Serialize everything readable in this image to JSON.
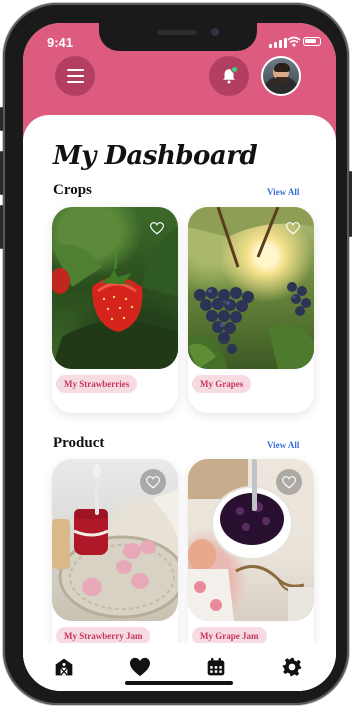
{
  "status_bar": {
    "time": "9:41"
  },
  "header": {
    "menu_icon": "hamburger-menu-icon",
    "notification_icon": "bell-icon",
    "notification_dot_color": "#39d17a",
    "avatar": "user-avatar"
  },
  "dashboard": {
    "title": "My Dashboard"
  },
  "crops": {
    "title": "Crops",
    "view_all": "View All",
    "items": [
      {
        "label": "My Strawberries",
        "image": "strawberry-plant-photo"
      },
      {
        "label": "My Grapes",
        "image": "grape-vine-photo"
      }
    ]
  },
  "products": {
    "title": "Product",
    "view_all": "View All",
    "items": [
      {
        "label": "My Strawberry Jam",
        "image": "strawberry-jam-photo"
      },
      {
        "label": "My Grape Jam",
        "image": "grape-jam-photo"
      }
    ]
  },
  "bottom_nav": {
    "items": [
      "barn-icon",
      "heart-icon",
      "calendar-icon",
      "gear-icon"
    ]
  },
  "colors": {
    "brand_pink": "#dd5b7e",
    "brand_dark_pink": "#b23e62",
    "pill_bg": "#f7dbe3",
    "pill_text": "#c6355e",
    "link_blue": "#3a6fd8"
  }
}
